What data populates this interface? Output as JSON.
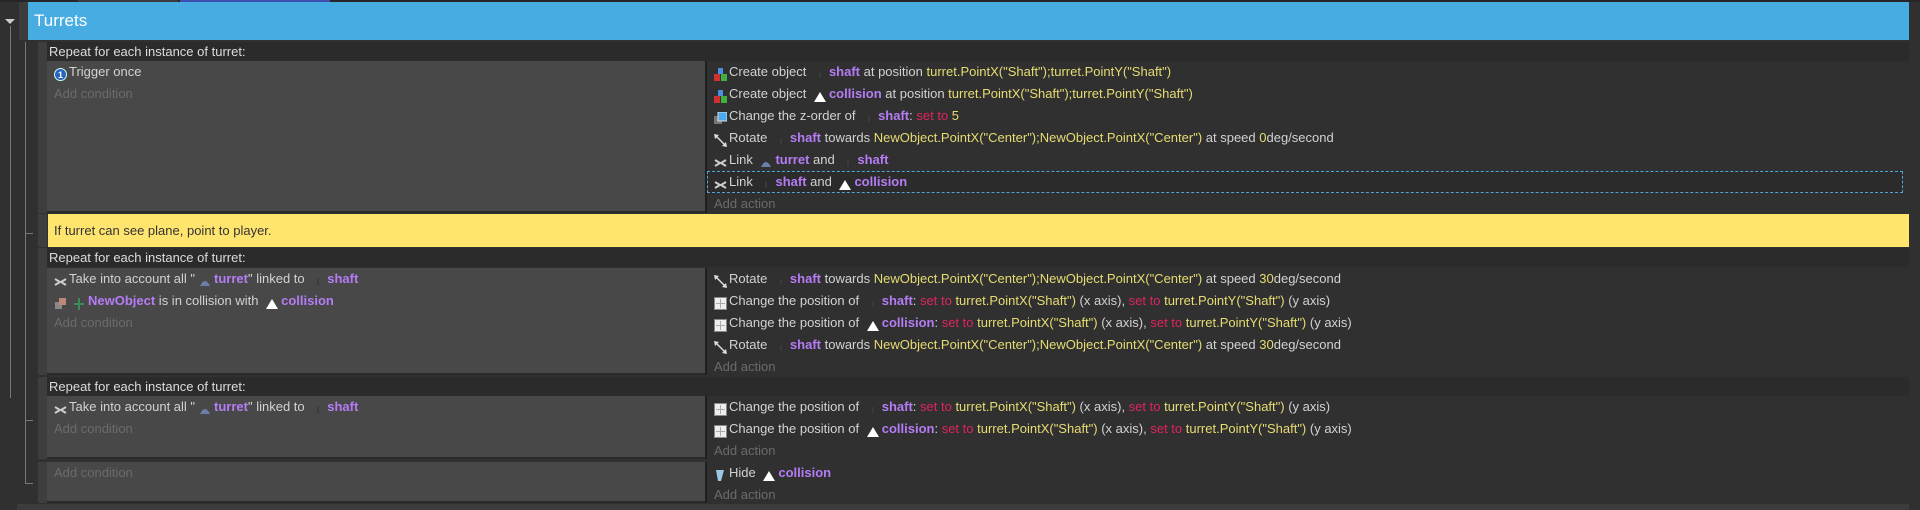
{
  "group": {
    "title": "Turrets"
  },
  "comment": "If turret can see plane, point to player.",
  "colors": {
    "group": "#47ace1",
    "comment": "#ffe46e",
    "object": "#b57cf5",
    "expression": "#e6dc72",
    "keyword": "#e0245e"
  },
  "add_condition": "Add condition",
  "add_action": "Add action",
  "events": [
    {
      "repeat": "Repeat for each instance of turret:",
      "conditions": [
        {
          "icon": "trigger-once",
          "parts": [
            {
              "k": "t",
              "v": "Trigger once"
            }
          ]
        }
      ],
      "actions": [
        {
          "icon": "create-object",
          "parts": [
            {
              "k": "t",
              "v": "Create object "
            },
            {
              "k": "oi",
              "v": "shaft"
            },
            {
              "k": "obj",
              "v": "shaft"
            },
            {
              "k": "t",
              "v": " at position "
            },
            {
              "k": "expr",
              "v": "turret.PointX(\"Shaft\");turret.PointY(\"Shaft\")"
            }
          ]
        },
        {
          "icon": "create-object",
          "parts": [
            {
              "k": "t",
              "v": "Create object "
            },
            {
              "k": "oi",
              "v": "collision"
            },
            {
              "k": "obj",
              "v": "collision"
            },
            {
              "k": "t",
              "v": " at position "
            },
            {
              "k": "expr",
              "v": "turret.PointX(\"Shaft\");turret.PointY(\"Shaft\")"
            }
          ]
        },
        {
          "icon": "z-order",
          "parts": [
            {
              "k": "t",
              "v": "Change the z-order of "
            },
            {
              "k": "oi",
              "v": "shaft"
            },
            {
              "k": "obj",
              "v": "shaft"
            },
            {
              "k": "t",
              "v": ": "
            },
            {
              "k": "kw",
              "v": "set to "
            },
            {
              "k": "expr",
              "v": "5"
            }
          ]
        },
        {
          "icon": "rotate",
          "parts": [
            {
              "k": "t",
              "v": "Rotate "
            },
            {
              "k": "oi",
              "v": "shaft"
            },
            {
              "k": "obj",
              "v": "shaft"
            },
            {
              "k": "t",
              "v": " towards "
            },
            {
              "k": "expr",
              "v": "NewObject.PointX(\"Center\");NewObject.PointX(\"Center\")"
            },
            {
              "k": "t",
              "v": " at speed "
            },
            {
              "k": "expr",
              "v": "0"
            },
            {
              "k": "t",
              "v": "deg/second"
            }
          ]
        },
        {
          "icon": "link",
          "parts": [
            {
              "k": "t",
              "v": "Link "
            },
            {
              "k": "oi",
              "v": "turret"
            },
            {
              "k": "obj",
              "v": "turret"
            },
            {
              "k": "t",
              "v": " and "
            },
            {
              "k": "oi",
              "v": "shaft"
            },
            {
              "k": "obj",
              "v": "shaft"
            }
          ]
        },
        {
          "icon": "link",
          "selected": true,
          "parts": [
            {
              "k": "t",
              "v": "Link "
            },
            {
              "k": "oi",
              "v": "shaft"
            },
            {
              "k": "obj",
              "v": "shaft"
            },
            {
              "k": "t",
              "v": " and "
            },
            {
              "k": "oi",
              "v": "collision"
            },
            {
              "k": "obj",
              "v": "collision"
            }
          ]
        }
      ]
    },
    {
      "repeat": "Repeat for each instance of turret:",
      "conditions": [
        {
          "icon": "link",
          "parts": [
            {
              "k": "t",
              "v": "Take into account all \""
            },
            {
              "k": "oi",
              "v": "turret"
            },
            {
              "k": "obj",
              "v": "turret"
            },
            {
              "k": "t",
              "v": "\" linked to "
            },
            {
              "k": "oi",
              "v": "shaft"
            },
            {
              "k": "obj",
              "v": "shaft"
            }
          ]
        },
        {
          "icon": "collision",
          "parts": [
            {
              "k": "oi",
              "v": "newobject"
            },
            {
              "k": "obj",
              "v": "NewObject"
            },
            {
              "k": "t",
              "v": " is in collision with "
            },
            {
              "k": "oi",
              "v": "collision"
            },
            {
              "k": "obj",
              "v": "collision"
            }
          ]
        }
      ],
      "actions": [
        {
          "icon": "rotate",
          "parts": [
            {
              "k": "t",
              "v": "Rotate "
            },
            {
              "k": "oi",
              "v": "shaft"
            },
            {
              "k": "obj",
              "v": "shaft"
            },
            {
              "k": "t",
              "v": " towards "
            },
            {
              "k": "expr",
              "v": "NewObject.PointX(\"Center\");NewObject.PointX(\"Center\")"
            },
            {
              "k": "t",
              "v": " at speed "
            },
            {
              "k": "expr",
              "v": "30"
            },
            {
              "k": "t",
              "v": "deg/second"
            }
          ]
        },
        {
          "icon": "position",
          "parts": [
            {
              "k": "t",
              "v": "Change the position of "
            },
            {
              "k": "oi",
              "v": "shaft"
            },
            {
              "k": "obj",
              "v": "shaft"
            },
            {
              "k": "t",
              "v": ": "
            },
            {
              "k": "kw",
              "v": "set to "
            },
            {
              "k": "expr",
              "v": "turret.PointX(\"Shaft\")"
            },
            {
              "k": "t",
              "v": " (x axis), "
            },
            {
              "k": "kw",
              "v": "set to "
            },
            {
              "k": "expr",
              "v": "turret.PointY(\"Shaft\")"
            },
            {
              "k": "t",
              "v": " (y axis)"
            }
          ]
        },
        {
          "icon": "position",
          "parts": [
            {
              "k": "t",
              "v": "Change the position of "
            },
            {
              "k": "oi",
              "v": "collision"
            },
            {
              "k": "obj",
              "v": "collision"
            },
            {
              "k": "t",
              "v": ": "
            },
            {
              "k": "kw",
              "v": "set to "
            },
            {
              "k": "expr",
              "v": "turret.PointX(\"Shaft\")"
            },
            {
              "k": "t",
              "v": " (x axis), "
            },
            {
              "k": "kw",
              "v": "set to "
            },
            {
              "k": "expr",
              "v": "turret.PointY(\"Shaft\")"
            },
            {
              "k": "t",
              "v": " (y axis)"
            }
          ]
        },
        {
          "icon": "rotate",
          "parts": [
            {
              "k": "t",
              "v": "Rotate "
            },
            {
              "k": "oi",
              "v": "shaft"
            },
            {
              "k": "obj",
              "v": "shaft"
            },
            {
              "k": "t",
              "v": " towards "
            },
            {
              "k": "expr",
              "v": "NewObject.PointX(\"Center\");NewObject.PointX(\"Center\")"
            },
            {
              "k": "t",
              "v": " at speed "
            },
            {
              "k": "expr",
              "v": "30"
            },
            {
              "k": "t",
              "v": "deg/second"
            }
          ]
        }
      ]
    },
    {
      "repeat": "Repeat for each instance of turret:",
      "conditions": [
        {
          "icon": "link",
          "parts": [
            {
              "k": "t",
              "v": "Take into account all \""
            },
            {
              "k": "oi",
              "v": "turret"
            },
            {
              "k": "obj",
              "v": "turret"
            },
            {
              "k": "t",
              "v": "\" linked to "
            },
            {
              "k": "oi",
              "v": "shaft"
            },
            {
              "k": "obj",
              "v": "shaft"
            }
          ]
        }
      ],
      "actions": [
        {
          "icon": "position",
          "parts": [
            {
              "k": "t",
              "v": "Change the position of "
            },
            {
              "k": "oi",
              "v": "shaft"
            },
            {
              "k": "obj",
              "v": "shaft"
            },
            {
              "k": "t",
              "v": ": "
            },
            {
              "k": "kw",
              "v": "set to "
            },
            {
              "k": "expr",
              "v": "turret.PointX(\"Shaft\")"
            },
            {
              "k": "t",
              "v": " (x axis), "
            },
            {
              "k": "kw",
              "v": "set to "
            },
            {
              "k": "expr",
              "v": "turret.PointY(\"Shaft\")"
            },
            {
              "k": "t",
              "v": " (y axis)"
            }
          ]
        },
        {
          "icon": "position",
          "parts": [
            {
              "k": "t",
              "v": "Change the position of "
            },
            {
              "k": "oi",
              "v": "collision"
            },
            {
              "k": "obj",
              "v": "collision"
            },
            {
              "k": "t",
              "v": ": "
            },
            {
              "k": "kw",
              "v": "set to "
            },
            {
              "k": "expr",
              "v": "turret.PointX(\"Shaft\")"
            },
            {
              "k": "t",
              "v": " (x axis), "
            },
            {
              "k": "kw",
              "v": "set to "
            },
            {
              "k": "expr",
              "v": "turret.PointY(\"Shaft\")"
            },
            {
              "k": "t",
              "v": " (y axis)"
            }
          ]
        }
      ]
    },
    {
      "conditions": [],
      "actions": [
        {
          "icon": "hide",
          "parts": [
            {
              "k": "t",
              "v": "Hide "
            },
            {
              "k": "oi",
              "v": "collision"
            },
            {
              "k": "obj",
              "v": "collision"
            }
          ]
        }
      ]
    }
  ]
}
